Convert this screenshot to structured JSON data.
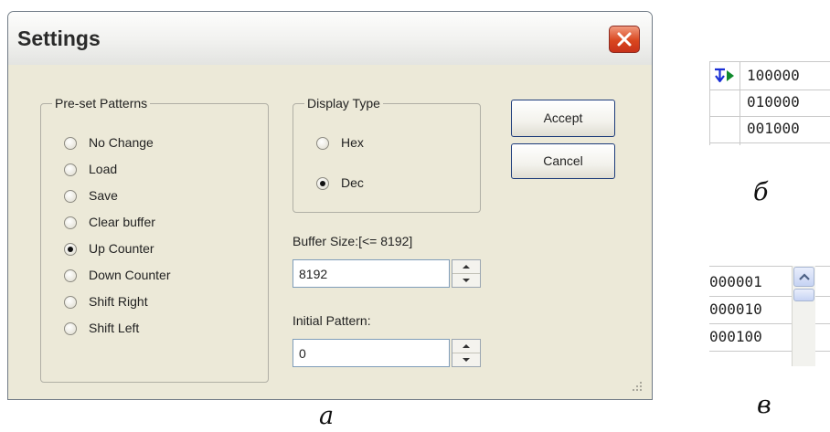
{
  "dialog": {
    "title": "Settings",
    "close_icon": "close-x-icon",
    "pattern_group": {
      "legend": "Pre-set Patterns",
      "options": [
        {
          "label": "No Change",
          "checked": false
        },
        {
          "label": "Load",
          "checked": false
        },
        {
          "label": "Save",
          "checked": false
        },
        {
          "label": "Clear buffer",
          "checked": false
        },
        {
          "label": "Up Counter",
          "checked": true
        },
        {
          "label": "Down Counter",
          "checked": false
        },
        {
          "label": "Shift Right",
          "checked": false
        },
        {
          "label": "Shift Left",
          "checked": false
        }
      ]
    },
    "display_group": {
      "legend": "Display Type",
      "options": [
        {
          "label": "Hex",
          "checked": false
        },
        {
          "label": "Dec",
          "checked": true
        }
      ]
    },
    "buffer_size": {
      "label": "Buffer Size:[<= 8192]",
      "value": "8192"
    },
    "initial_pattern": {
      "label": "Initial Pattern:",
      "value": "0"
    },
    "accept_label": "Accept",
    "cancel_label": "Cancel"
  },
  "panel_b": {
    "rows": [
      "100000",
      "010000",
      "001000"
    ],
    "marker_icon": "step-arrow-icon"
  },
  "panel_c": {
    "rows": [
      "000001",
      "000010",
      "000100"
    ],
    "scroll_icon": "scroll-up-arrow-icon"
  },
  "captions": {
    "a": "а",
    "b": "б",
    "c": "в"
  },
  "colors": {
    "dialog_bg": "#ece9d8",
    "close_button": "#d9471f",
    "button_border": "#1c3b7a",
    "marker_blue": "#1a2fd6",
    "marker_green": "#0f8a2c"
  }
}
